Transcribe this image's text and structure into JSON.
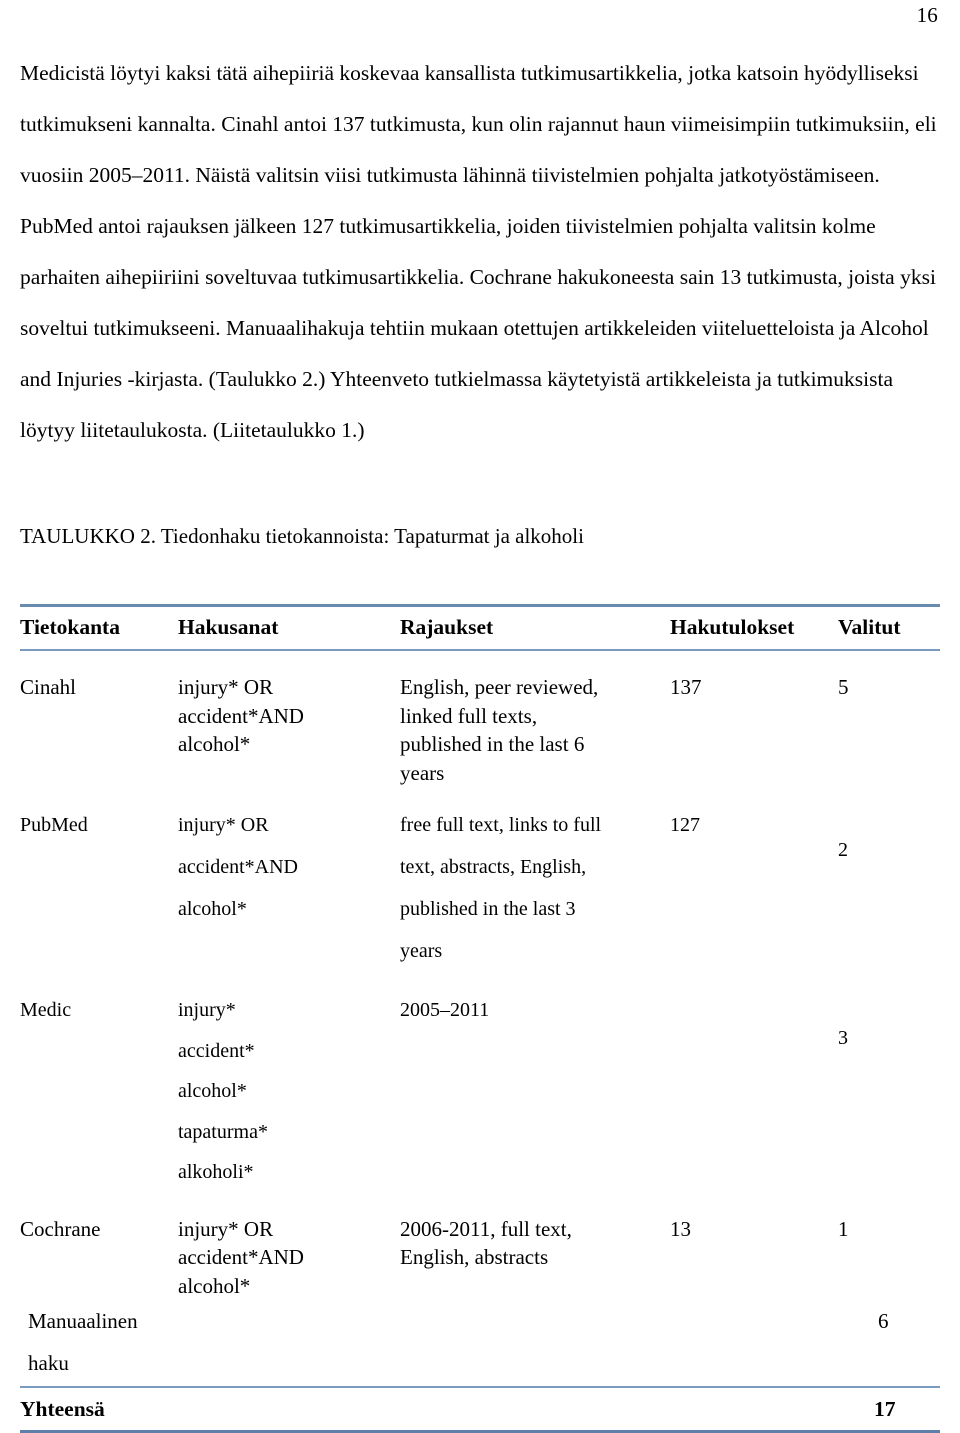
{
  "page": {
    "number": "16"
  },
  "body": {
    "paragraphs": [
      "Medicistä löytyi kaksi tätä aihepiiriä koskevaa kansallista tutkimusartikkelia, jotka katsoin hyödylliseksi tutkimukseni kannalta.  Cinahl antoi 137 tutkimusta, kun olin rajannut haun viimeisimpiin tutkimuksiin, eli vuosiin 2005–2011. Näistä valitsin viisi tutkimusta lähinnä tiivistelmien pohjalta jatkotyöstämiseen. PubMed antoi rajauksen jälkeen 127 tutkimusartikkelia, joiden tiivistelmien pohjalta valitsin kolme parhaiten aihepiiriini soveltuvaa tutkimusartikkelia. Cochrane hakukoneesta sain 13 tutkimusta, joista yksi soveltui tutkimukseeni. Manuaalihakuja tehtiin mukaan otettujen artikkeleiden viiteluetteloista ja Alcohol and Injuries -kirjasta. (Taulukko 2.) Yhteenveto tutkielmassa käytetyistä artikkeleista ja tutkimuksista löytyy liitetaulukosta. (Liitetaulukko 1.)"
    ]
  },
  "table": {
    "caption": "TAULUKKO 2. Tiedonhaku tietokannoista: Tapaturmat ja alkoholi",
    "rule_color": "#6a8bb0",
    "headers": [
      "Tietokanta",
      "Hakusanat",
      "Rajaukset",
      "Hakutulokset",
      "Valitut"
    ],
    "rows": [
      {
        "database": "Cinahl",
        "keywords": [
          "injury* OR",
          "accident*AND",
          "alcohol*"
        ],
        "limits": [
          "English, peer reviewed,",
          "linked full texts,",
          "published in the last 6",
          "years"
        ],
        "results": "137",
        "selected": "5"
      },
      {
        "database": "PubMed",
        "keywords": [
          "injury* OR",
          "accident*AND",
          "alcohol*"
        ],
        "limits": [
          "free full text, links to full",
          "text, abstracts, English,",
          "published in the last 3",
          "years"
        ],
        "results": "127",
        "selected": "2"
      },
      {
        "database": "Medic",
        "keywords": [
          "injury*",
          "accident*",
          "alcohol*",
          "tapaturma*",
          "alkoholi*"
        ],
        "limits": [
          "2005–2011"
        ],
        "results": "",
        "selected": "3"
      },
      {
        "database": "Cochrane",
        "keywords": [
          "injury* OR",
          "accident*AND",
          "alcohol*"
        ],
        "limits": [
          "2006-2011, full text,",
          "English, abstracts"
        ],
        "results": "13",
        "selected": "1"
      },
      {
        "database": "Manuaalinen haku",
        "keywords": [],
        "limits": [],
        "results": "",
        "selected": "6"
      }
    ],
    "total": {
      "label": "Yhteensä",
      "keywords": "",
      "limits": "",
      "results": "",
      "selected": "17"
    }
  }
}
